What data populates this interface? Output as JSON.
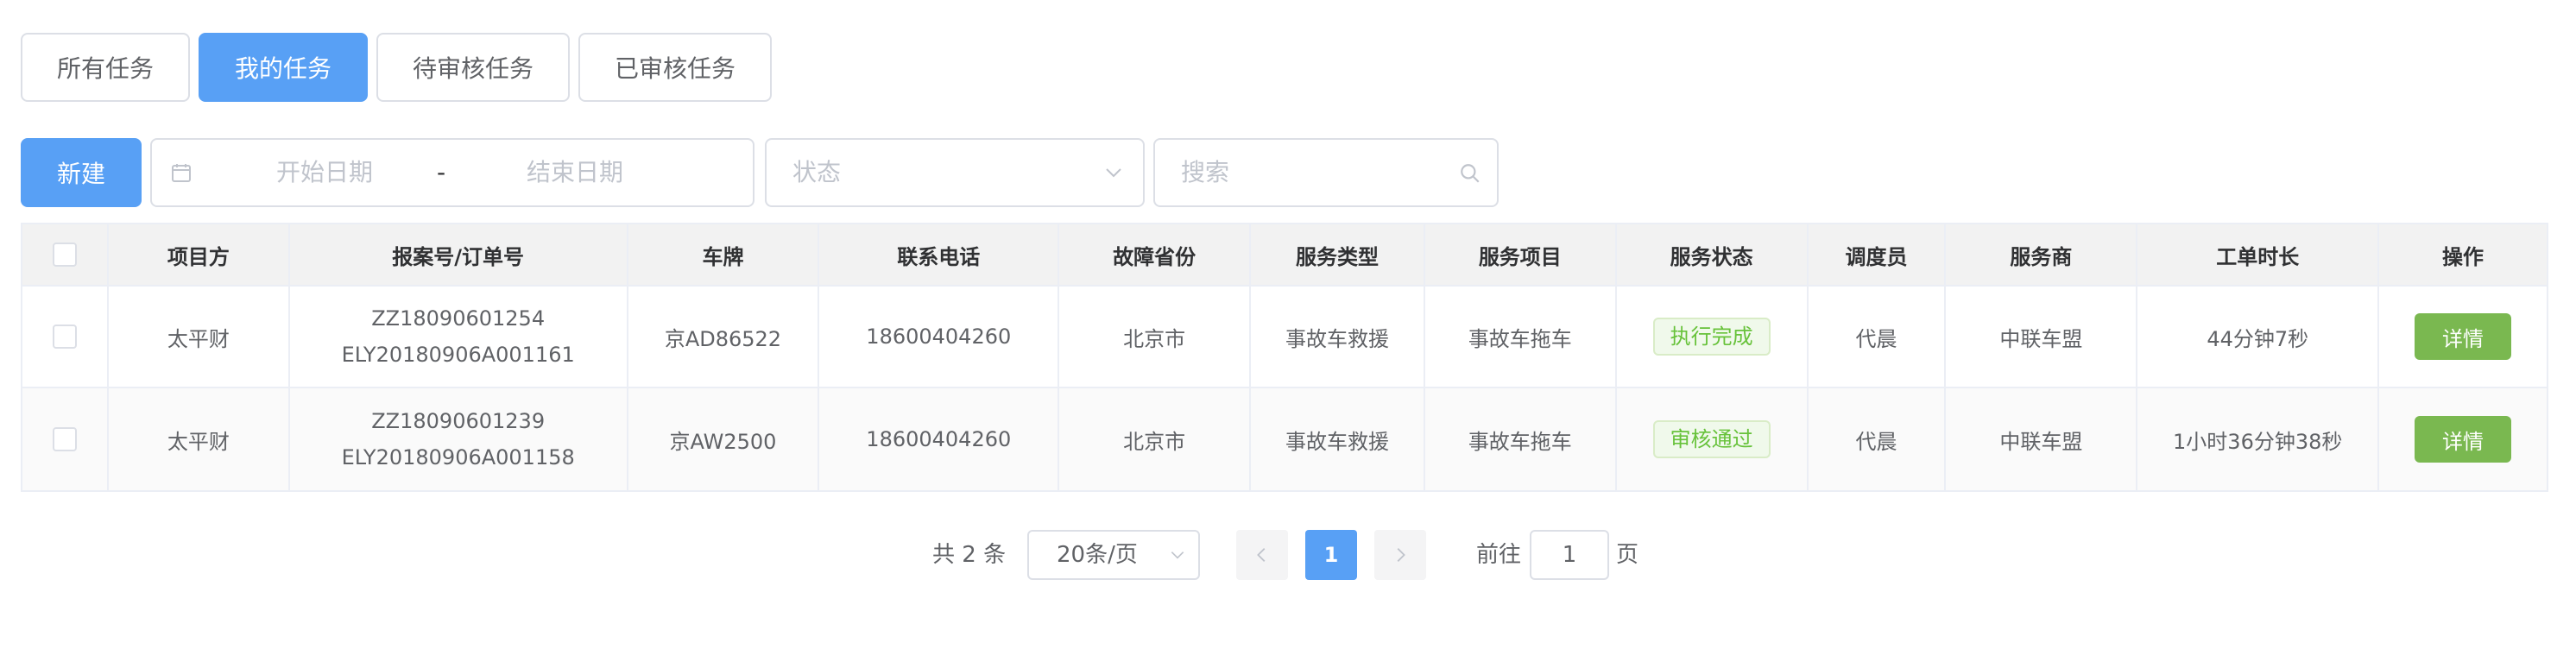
{
  "tabs": [
    {
      "label": "所有任务",
      "active": false
    },
    {
      "label": "我的任务",
      "active": true
    },
    {
      "label": "待审核任务",
      "active": false
    },
    {
      "label": "已审核任务",
      "active": false
    }
  ],
  "toolbar": {
    "new_label": "新建",
    "date_start_placeholder": "开始日期",
    "date_separator": "-",
    "date_end_placeholder": "结束日期",
    "status_placeholder": "状态",
    "search_placeholder": "搜索"
  },
  "table": {
    "headers": [
      "项目方",
      "报案号/订单号",
      "车牌",
      "联系电话",
      "故障省份",
      "服务类型",
      "服务项目",
      "服务状态",
      "调度员",
      "服务商",
      "工单时长",
      "操作"
    ],
    "rows": [
      {
        "project": "太平财",
        "case_no": "ZZ18090601254",
        "order_no": "ELY20180906A001161",
        "plate": "京AD86522",
        "phone": "18600404260",
        "province": "北京市",
        "service_type": "事故车救援",
        "service_item": "事故车拖车",
        "status": "执行完成",
        "dispatcher": "代晨",
        "provider": "中联车盟",
        "duration": "44分钟7秒",
        "action": "详情"
      },
      {
        "project": "太平财",
        "case_no": "ZZ18090601239",
        "order_no": "ELY20180906A001158",
        "plate": "京AW2500",
        "phone": "18600404260",
        "province": "北京市",
        "service_type": "事故车救援",
        "service_item": "事故车拖车",
        "status": "审核通过",
        "dispatcher": "代晨",
        "provider": "中联车盟",
        "duration": "1小时36分钟38秒",
        "action": "详情"
      }
    ]
  },
  "pagination": {
    "total_text": "共 2 条",
    "page_size": "20条/页",
    "current_page": "1",
    "goto_label": "前往",
    "goto_value": "1",
    "page_unit": "页"
  },
  "colors": {
    "primary": "#58a0f5",
    "success_button": "#7ab850",
    "tag_green": "#67c23a"
  }
}
